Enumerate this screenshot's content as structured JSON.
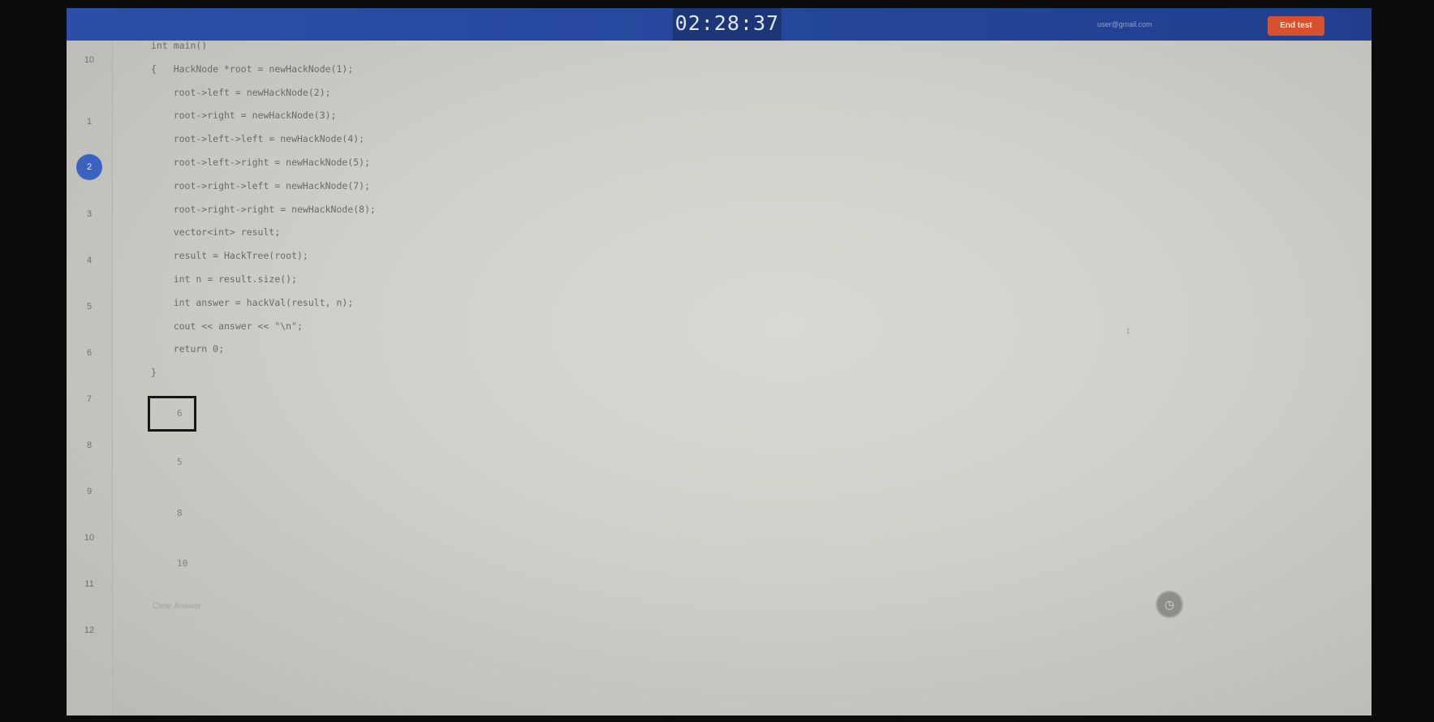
{
  "header": {
    "timer": "02:28:37",
    "email": "user@gmail.com",
    "end_button": "End test",
    "accent_color": "#2c4ea6",
    "end_button_color": "#d8512f"
  },
  "question_nav": {
    "items": [
      "10",
      "1",
      "2",
      "3",
      "4",
      "5",
      "6",
      "7",
      "8",
      "9",
      "10",
      "11",
      "12"
    ],
    "active_index": 2
  },
  "code_lines": [
    "int main()",
    "{   HackNode *root = newHackNode(1);",
    "    root->left = newHackNode(2);",
    "    root->right = newHackNode(3);",
    "    root->left->left = newHackNode(4);",
    "    root->left->right = newHackNode(5);",
    "    root->right->left = newHackNode(7);",
    "    root->right->right = newHackNode(8);",
    "    vector<int> result;",
    "    result = HackTree(root);",
    "    int n = result.size();",
    "    int answer = hackVal(result, n);",
    "    cout << answer << \"\\n\";",
    "    return 0;",
    "}"
  ],
  "options": [
    "6",
    "5",
    "8",
    "10"
  ],
  "selected_option_index": 0,
  "clear_label": "Clear Answer",
  "help_icon": "clock-icon",
  "scroll_marker": "↕"
}
